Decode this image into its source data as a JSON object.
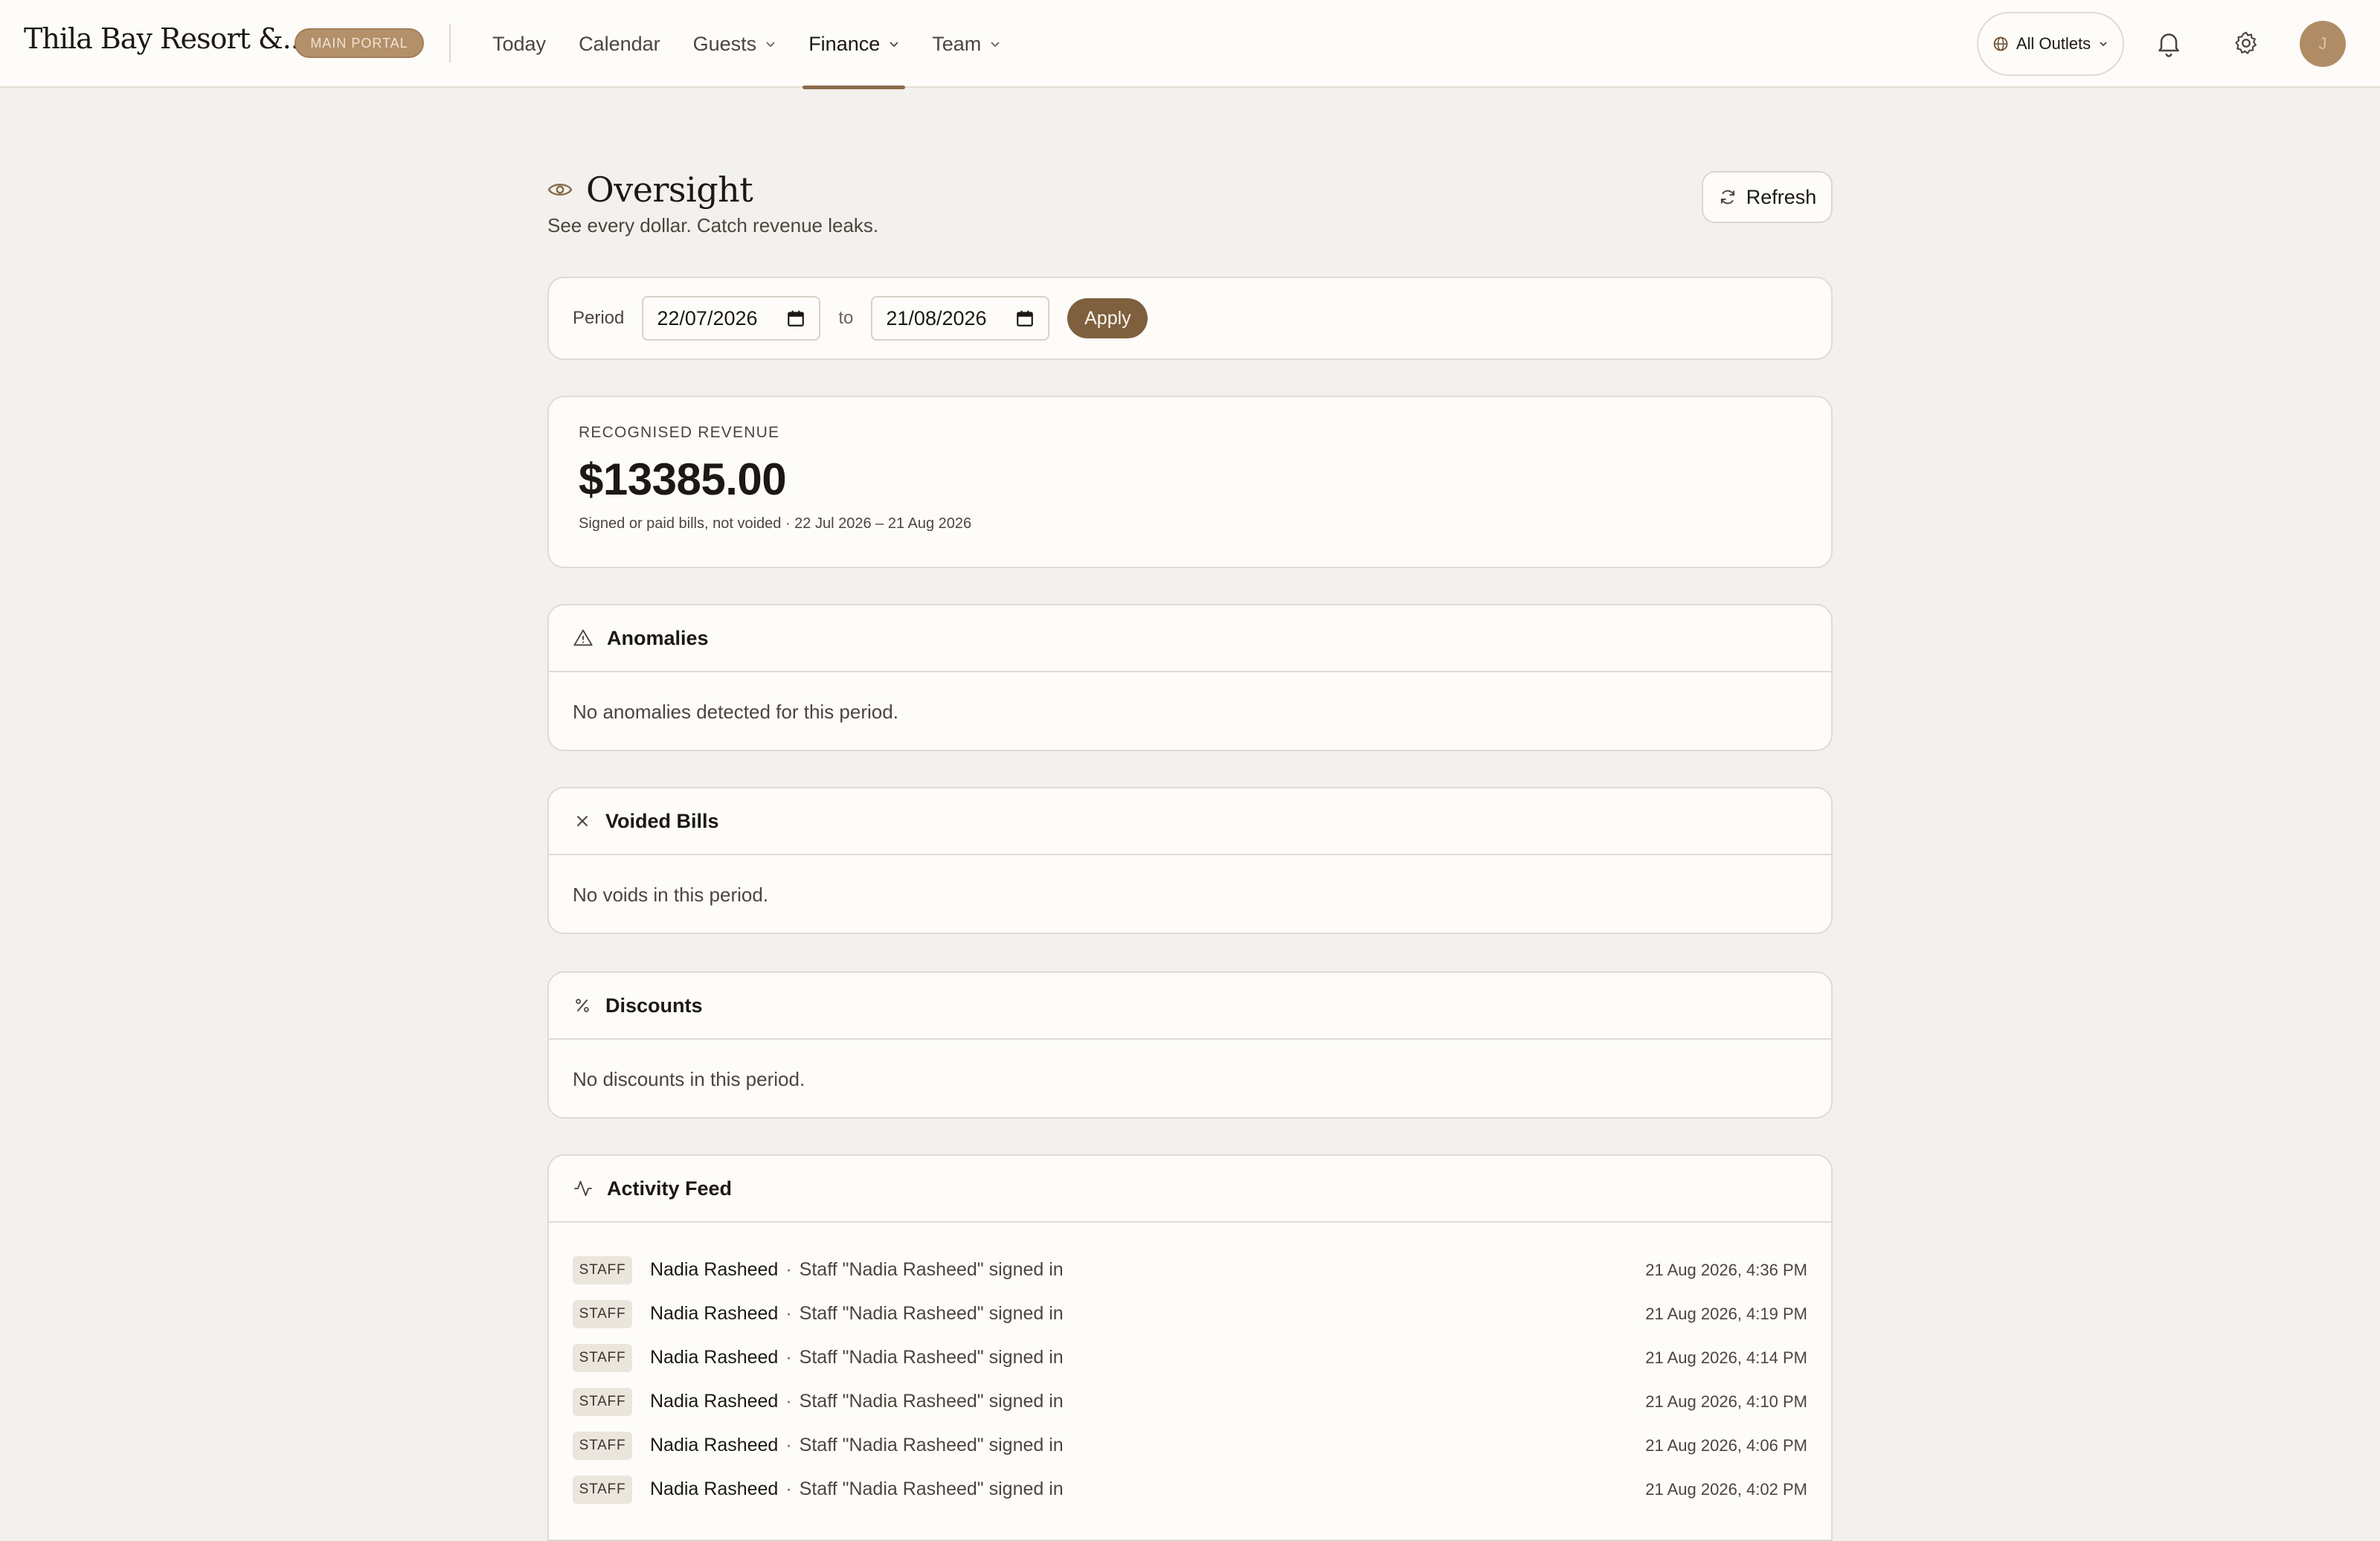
{
  "header": {
    "brand": "Thila Bay Resort &...",
    "portal_badge": "MAIN PORTAL",
    "nav": [
      {
        "label": "Today"
      },
      {
        "label": "Calendar"
      },
      {
        "label": "Guests",
        "has_dropdown": true
      },
      {
        "label": "Finance",
        "has_dropdown": true,
        "active": true
      },
      {
        "label": "Team",
        "has_dropdown": true
      }
    ],
    "outlet_selector": "All Outlets",
    "avatar_initial": "J",
    "icons": [
      "globe-icon",
      "bell-icon",
      "gear-icon"
    ]
  },
  "page": {
    "title": "Oversight",
    "title_icon": "eye-icon",
    "subtitle": "See every dollar. Catch revenue leaks.",
    "refresh_label": "Refresh"
  },
  "period": {
    "label": "Period",
    "from": "22/07/2026",
    "to_label": "to",
    "to": "21/08/2026",
    "apply_label": "Apply"
  },
  "revenue": {
    "label": "RECOGNISED REVENUE",
    "value": "$13385.00",
    "note": "Signed or paid bills, not voided · 22 Jul 2026 – 21 Aug 2026"
  },
  "sections": {
    "anomalies": {
      "title": "Anomalies",
      "icon": "warning-icon",
      "empty": "No anomalies detected for this period."
    },
    "voided": {
      "title": "Voided Bills",
      "icon": "close-icon",
      "empty": "No voids in this period."
    },
    "discounts": {
      "title": "Discounts",
      "icon": "percent-icon",
      "empty": "No discounts in this period."
    },
    "activity": {
      "title": "Activity Feed",
      "icon": "activity-icon"
    }
  },
  "activity": [
    {
      "tag": "STAFF",
      "name": "Nadia Rasheed",
      "message": "Staff \"Nadia Rasheed\" signed in",
      "time": "21 Aug 2026, 4:36 PM"
    },
    {
      "tag": "STAFF",
      "name": "Nadia Rasheed",
      "message": "Staff \"Nadia Rasheed\" signed in",
      "time": "21 Aug 2026, 4:19 PM"
    },
    {
      "tag": "STAFF",
      "name": "Nadia Rasheed",
      "message": "Staff \"Nadia Rasheed\" signed in",
      "time": "21 Aug 2026, 4:14 PM"
    },
    {
      "tag": "STAFF",
      "name": "Nadia Rasheed",
      "message": "Staff \"Nadia Rasheed\" signed in",
      "time": "21 Aug 2026, 4:10 PM"
    },
    {
      "tag": "STAFF",
      "name": "Nadia Rasheed",
      "message": "Staff \"Nadia Rasheed\" signed in",
      "time": "21 Aug 2026, 4:06 PM"
    },
    {
      "tag": "STAFF",
      "name": "Nadia Rasheed",
      "message": "Staff \"Nadia Rasheed\" signed in",
      "time": "21 Aug 2026, 4:02 PM"
    }
  ]
}
